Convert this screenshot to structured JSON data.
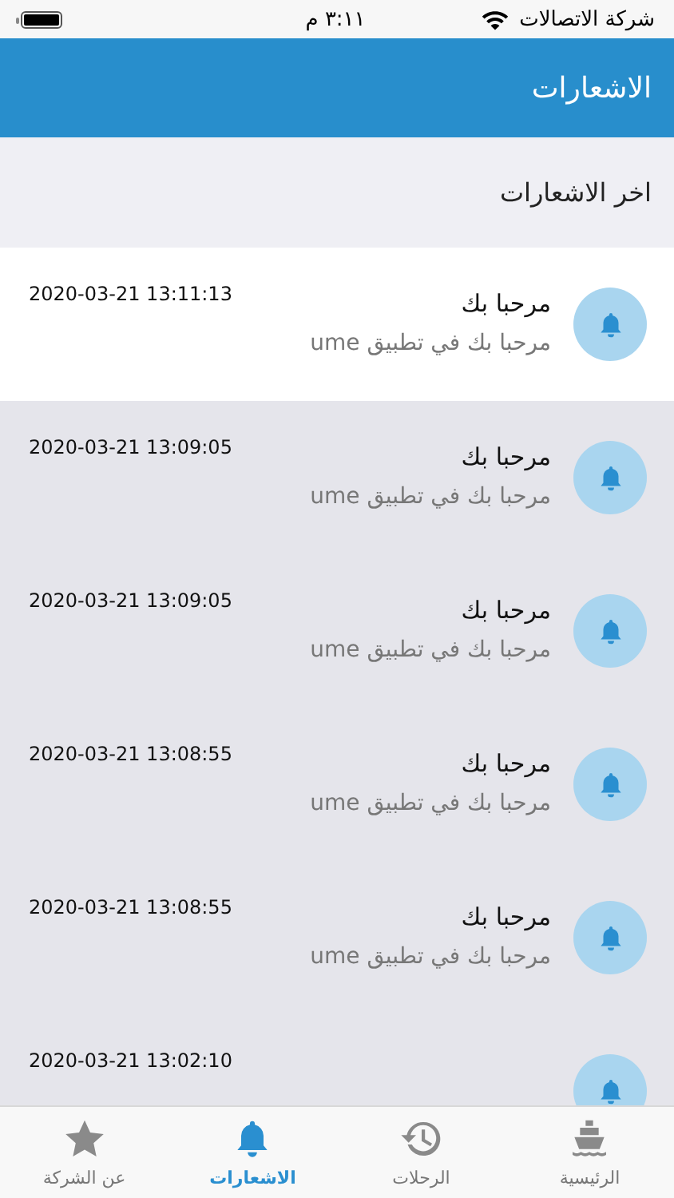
{
  "status_bar": {
    "carrier": "شركة الاتصالات",
    "time": "٣:١١ م"
  },
  "header": {
    "title": "الاشعارات"
  },
  "section_title": "اخر الاشعارات",
  "notifications": [
    {
      "title": "مرحبا بك",
      "message": "مرحبا بك في تطبيق  ume",
      "time": "2020-03-21 13:11:13",
      "selected": true
    },
    {
      "title": "مرحبا بك",
      "message": "مرحبا بك في تطبيق  ume",
      "time": "2020-03-21 13:09:05",
      "selected": false
    },
    {
      "title": "مرحبا بك",
      "message": "مرحبا بك في تطبيق  ume",
      "time": "2020-03-21 13:09:05",
      "selected": false
    },
    {
      "title": "مرحبا بك",
      "message": "مرحبا بك في تطبيق  ume",
      "time": "2020-03-21 13:08:55",
      "selected": false
    },
    {
      "title": "مرحبا بك",
      "message": "مرحبا بك في تطبيق  ume",
      "time": "2020-03-21 13:08:55",
      "selected": false
    },
    {
      "time": "2020-03-21 13:02:10",
      "selected": false
    }
  ],
  "tabs": [
    {
      "label": "الرئيسية",
      "kind": "ship",
      "selected": false
    },
    {
      "label": "الرحلات",
      "kind": "history",
      "selected": false
    },
    {
      "label": "الاشعارات",
      "kind": "bell",
      "selected": true
    },
    {
      "label": "عن الشركة",
      "kind": "star",
      "selected": false
    }
  ]
}
